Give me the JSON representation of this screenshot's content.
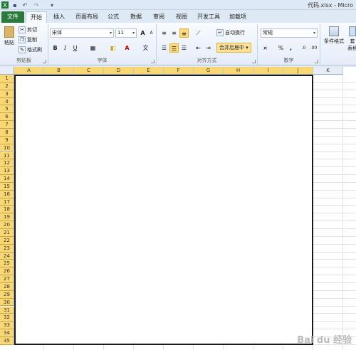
{
  "titlebar": {
    "title": "代码.xlsx - Micro",
    "qat_icons": [
      "excel-logo-icon",
      "save-icon",
      "undo-icon",
      "redo-icon",
      "customize-icon"
    ]
  },
  "tabs": [
    "文件",
    "开始",
    "插入",
    "页面布局",
    "公式",
    "数据",
    "审阅",
    "视图",
    "开发工具",
    "加载项"
  ],
  "ribbon": {
    "clipboard": {
      "label": "剪贴板",
      "paste": "粘贴",
      "cut": "剪切",
      "copy": "复制",
      "format_painter": "格式刷"
    },
    "font": {
      "label": "字体",
      "font_name": "宋体",
      "font_size": "11",
      "grow": "A",
      "shrink": "A",
      "bold": "B",
      "italic": "I",
      "underline": "U"
    },
    "alignment": {
      "label": "对齐方式",
      "wrap_text": "自动换行",
      "merge_center": "合并后居中"
    },
    "number": {
      "label": "数字",
      "format": "常规",
      "percent": "%",
      "comma": ","
    },
    "styles": {
      "conditional": "条件格式",
      "table": "套",
      "table2": "表格"
    }
  },
  "grid": {
    "columns": [
      "A",
      "B",
      "C",
      "D",
      "E",
      "F",
      "G",
      "H",
      "I",
      "J",
      "K"
    ],
    "rows": [
      "1",
      "2",
      "3",
      "4",
      "5",
      "6",
      "7",
      "8",
      "9",
      "10",
      "11",
      "12",
      "13",
      "14",
      "15",
      "16",
      "17",
      "18",
      "19",
      "20",
      "21",
      "22",
      "23",
      "24",
      "25",
      "26",
      "27",
      "28",
      "29",
      "30",
      "31",
      "32",
      "33",
      "34",
      "35"
    ]
  },
  "watermark": "Bai du 经验"
}
